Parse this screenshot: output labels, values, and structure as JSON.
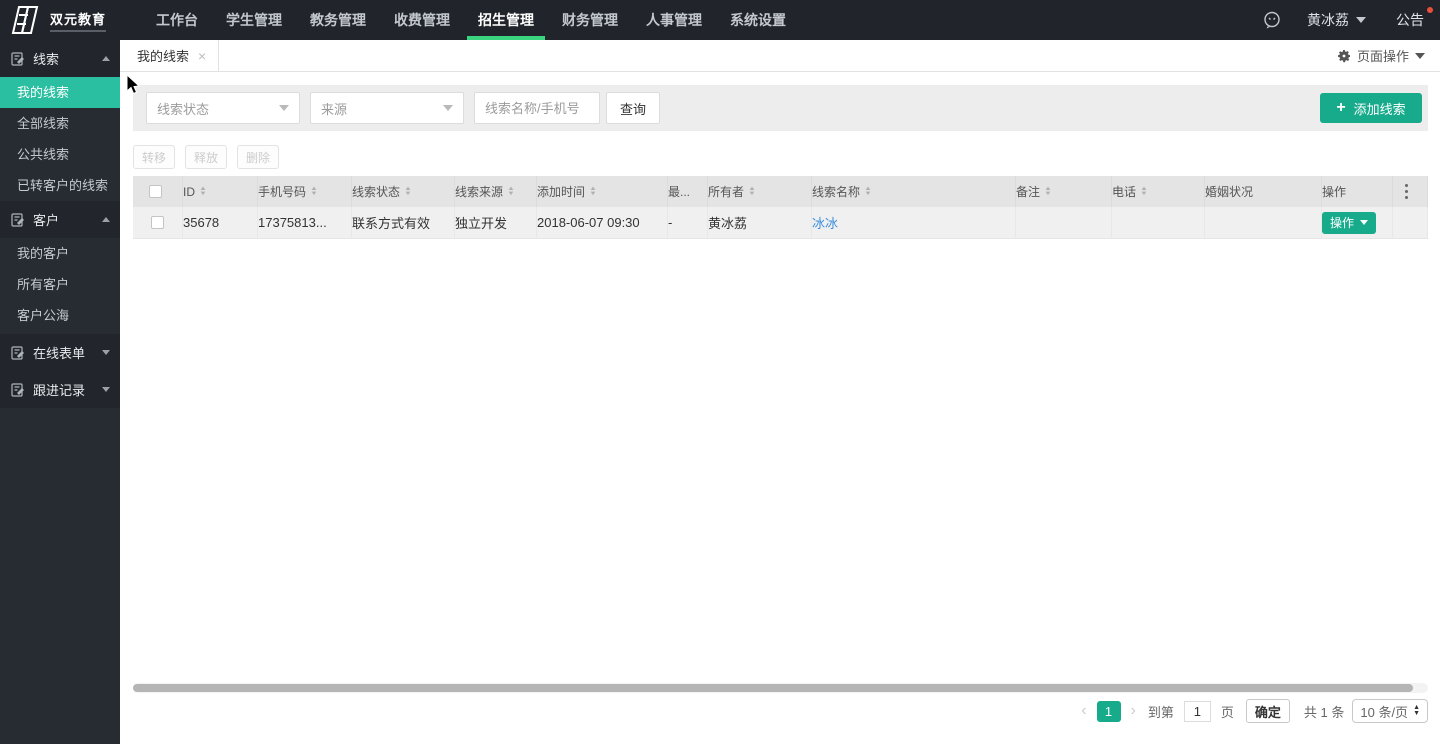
{
  "topbar": {
    "brand_name": "双元教育",
    "menu": [
      {
        "label": "工作台",
        "active": false
      },
      {
        "label": "学生管理",
        "active": false
      },
      {
        "label": "教务管理",
        "active": false
      },
      {
        "label": "收费管理",
        "active": false
      },
      {
        "label": "招生管理",
        "active": true
      },
      {
        "label": "财务管理",
        "active": false
      },
      {
        "label": "人事管理",
        "active": false
      },
      {
        "label": "系统设置",
        "active": false
      }
    ],
    "user_name": "黄冰荔",
    "announcement_label": "公告"
  },
  "sidebar": {
    "groups": [
      {
        "label": "线索",
        "expanded": true
      },
      {
        "label": "客户",
        "expanded": true
      },
      {
        "label": "在线表单",
        "expanded": false
      },
      {
        "label": "跟进记录",
        "expanded": false
      }
    ],
    "lead_items": [
      {
        "label": "我的线索",
        "active": true
      },
      {
        "label": "全部线索",
        "active": false
      },
      {
        "label": "公共线索",
        "active": false
      },
      {
        "label": "已转客户的线索",
        "active": false
      }
    ],
    "customer_items": [
      {
        "label": "我的客户",
        "active": false
      },
      {
        "label": "所有客户",
        "active": false
      },
      {
        "label": "客户公海",
        "active": false
      }
    ]
  },
  "tabs": {
    "active_tab": "我的线索",
    "close_glyph": "×",
    "page_actions_label": "页面操作"
  },
  "filters": {
    "lead_status_placeholder": "线索状态",
    "source_placeholder": "来源",
    "keyword_placeholder": "线索名称/手机号",
    "search_label": "查询",
    "add_lead_label": "添加线索",
    "add_plus": "+"
  },
  "bulk_actions": {
    "transfer": "转移",
    "release": "释放",
    "delete": "删除"
  },
  "table": {
    "columns": [
      {
        "label": "ID",
        "sortable": true
      },
      {
        "label": "手机号码",
        "sortable": true
      },
      {
        "label": "线索状态",
        "sortable": true
      },
      {
        "label": "线索来源",
        "sortable": true
      },
      {
        "label": "添加时间",
        "sortable": true
      },
      {
        "label": "最...",
        "sortable": false
      },
      {
        "label": "所有者",
        "sortable": true
      },
      {
        "label": "线索名称",
        "sortable": true
      },
      {
        "label": "备注",
        "sortable": true
      },
      {
        "label": "电话",
        "sortable": true
      },
      {
        "label": "婚姻状况",
        "sortable": false
      },
      {
        "label": "操作",
        "sortable": false
      }
    ],
    "rows": [
      {
        "id": "35678",
        "phone": "17375813...",
        "lead_status": "联系方式有效",
        "lead_source": "独立开发",
        "added_time": "2018-06-07 09:30",
        "recent": "-",
        "owner": "黄冰荔",
        "lead_name": "冰冰",
        "remark": "",
        "tel": "",
        "marital": "",
        "action_label": "操作"
      }
    ]
  },
  "pagination": {
    "prev_glyph": "‹",
    "next_glyph": "›",
    "current_page": "1",
    "goto_label": "到第",
    "goto_value": "1",
    "page_unit_label": "页",
    "confirm_label": "确定",
    "total_label": "共 1 条",
    "page_size_label": "10 条/页"
  },
  "colors": {
    "accent_green": "#17ab8c",
    "sidebar_active_green": "#2abfa0",
    "nav_underline_green": "#3ad47f",
    "link_blue": "#3d8fdd",
    "notice_dot_red": "#e8503a",
    "topbar_bg": "#21252b",
    "sidebar_bg": "#272c33"
  }
}
